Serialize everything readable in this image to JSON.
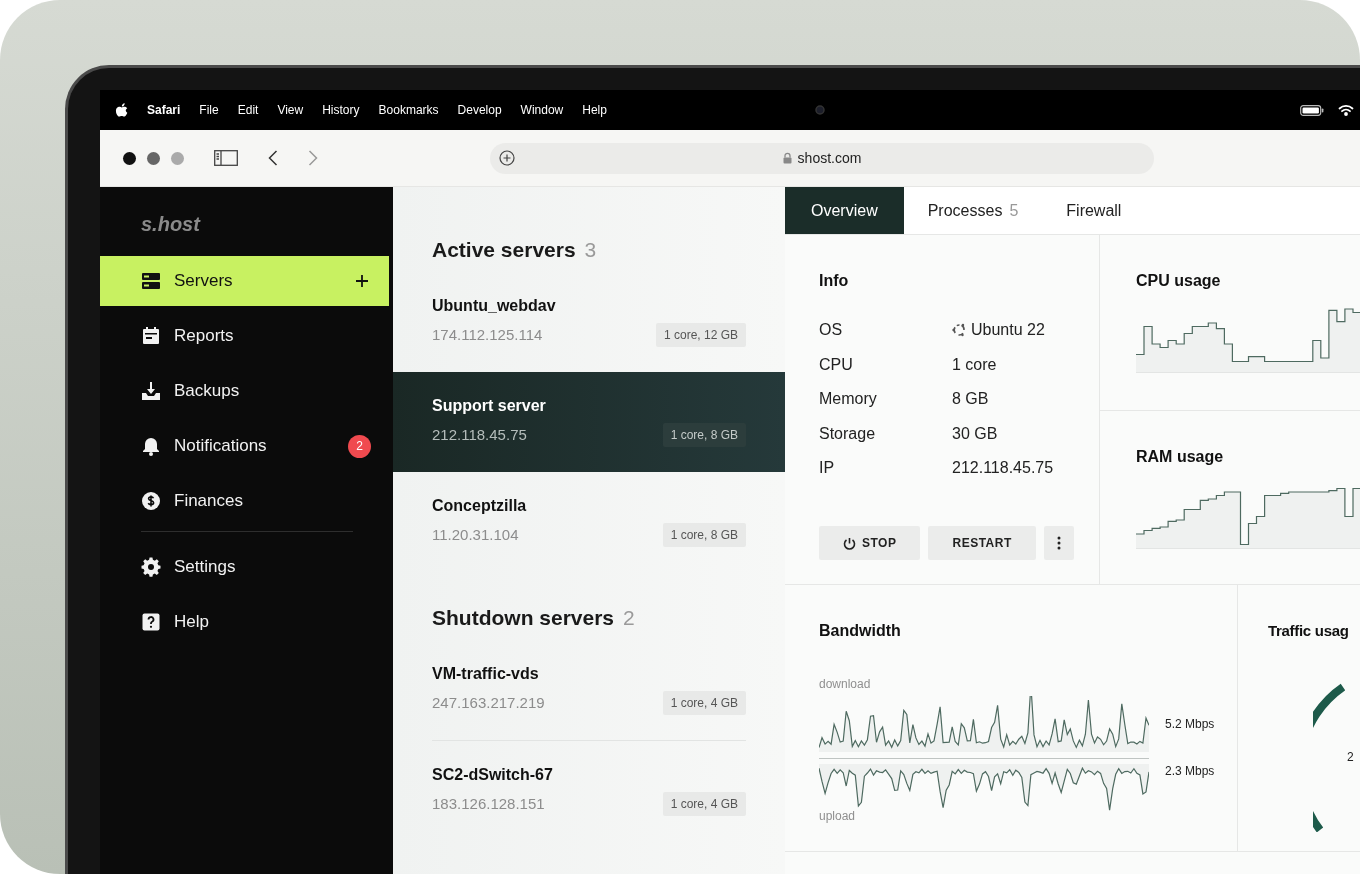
{
  "menu_bar": {
    "app_name": "Safari",
    "menus": [
      "File",
      "Edit",
      "View",
      "History",
      "Bookmarks",
      "Develop",
      "Window",
      "Help"
    ]
  },
  "browser": {
    "address": "shost.com"
  },
  "sidebar": {
    "logo": "s.host",
    "items": [
      {
        "label": "Servers",
        "selected": true
      },
      {
        "label": "Reports",
        "selected": false
      },
      {
        "label": "Backups",
        "selected": false
      },
      {
        "label": "Notifications",
        "selected": false,
        "badge": "2"
      },
      {
        "label": "Finances",
        "selected": false
      }
    ],
    "bottom_items": [
      {
        "label": "Settings",
        "selected": false
      },
      {
        "label": "Help",
        "selected": false
      }
    ]
  },
  "server_groups": [
    {
      "title": "Active servers",
      "count": "3",
      "servers": [
        {
          "name": "Ubuntu_webdav",
          "ip": "174.112.125.114",
          "spec": "1 core, 12 GB",
          "selected": false
        },
        {
          "name": "Support server",
          "ip": "212.118.45.75",
          "spec": "1 core, 8 GB",
          "selected": true
        },
        {
          "name": "Conceptzilla",
          "ip": "11.20.31.104",
          "spec": "1 core, 8 GB",
          "selected": false
        }
      ]
    },
    {
      "title": "Shutdown servers",
      "count": "2",
      "servers": [
        {
          "name": "VM-traffic-vds",
          "ip": "247.163.217.219",
          "spec": "1 core, 4 GB",
          "selected": false
        },
        {
          "name": "SC2-dSwitch-67",
          "ip": "183.126.128.151",
          "spec": "1 core, 4 GB",
          "selected": false
        }
      ]
    }
  ],
  "detail": {
    "tabs": [
      {
        "label": "Overview",
        "selected": true
      },
      {
        "label": "Processes",
        "count": "5",
        "selected": false
      },
      {
        "label": "Firewall",
        "selected": false
      }
    ],
    "info": {
      "title": "Info",
      "rows": [
        {
          "label": "OS",
          "value": "Ubuntu 22",
          "kind": "os"
        },
        {
          "label": "CPU",
          "value": "1 core",
          "kind": "plain"
        },
        {
          "label": "Memory",
          "value": "8 GB",
          "kind": "plain"
        },
        {
          "label": "Storage",
          "value": "30 GB",
          "kind": "plain"
        },
        {
          "label": "IP",
          "value": "212.118.45.75",
          "kind": "plain"
        }
      ],
      "buttons": [
        {
          "label": "STOP",
          "kind": "power"
        },
        {
          "label": "RESTART",
          "kind": "plain"
        }
      ]
    },
    "cpu_usage": {
      "title": "CPU usage"
    },
    "ram_usage": {
      "title": "RAM usage"
    },
    "bandwidth": {
      "title": "Bandwidth",
      "download_label": "download",
      "upload_label": "upload",
      "download_reading": "5.2 Mbps",
      "upload_reading": "2.3 Mbps"
    },
    "traffic_usage": {
      "title": "Traffic usag",
      "reading": "2"
    }
  }
}
